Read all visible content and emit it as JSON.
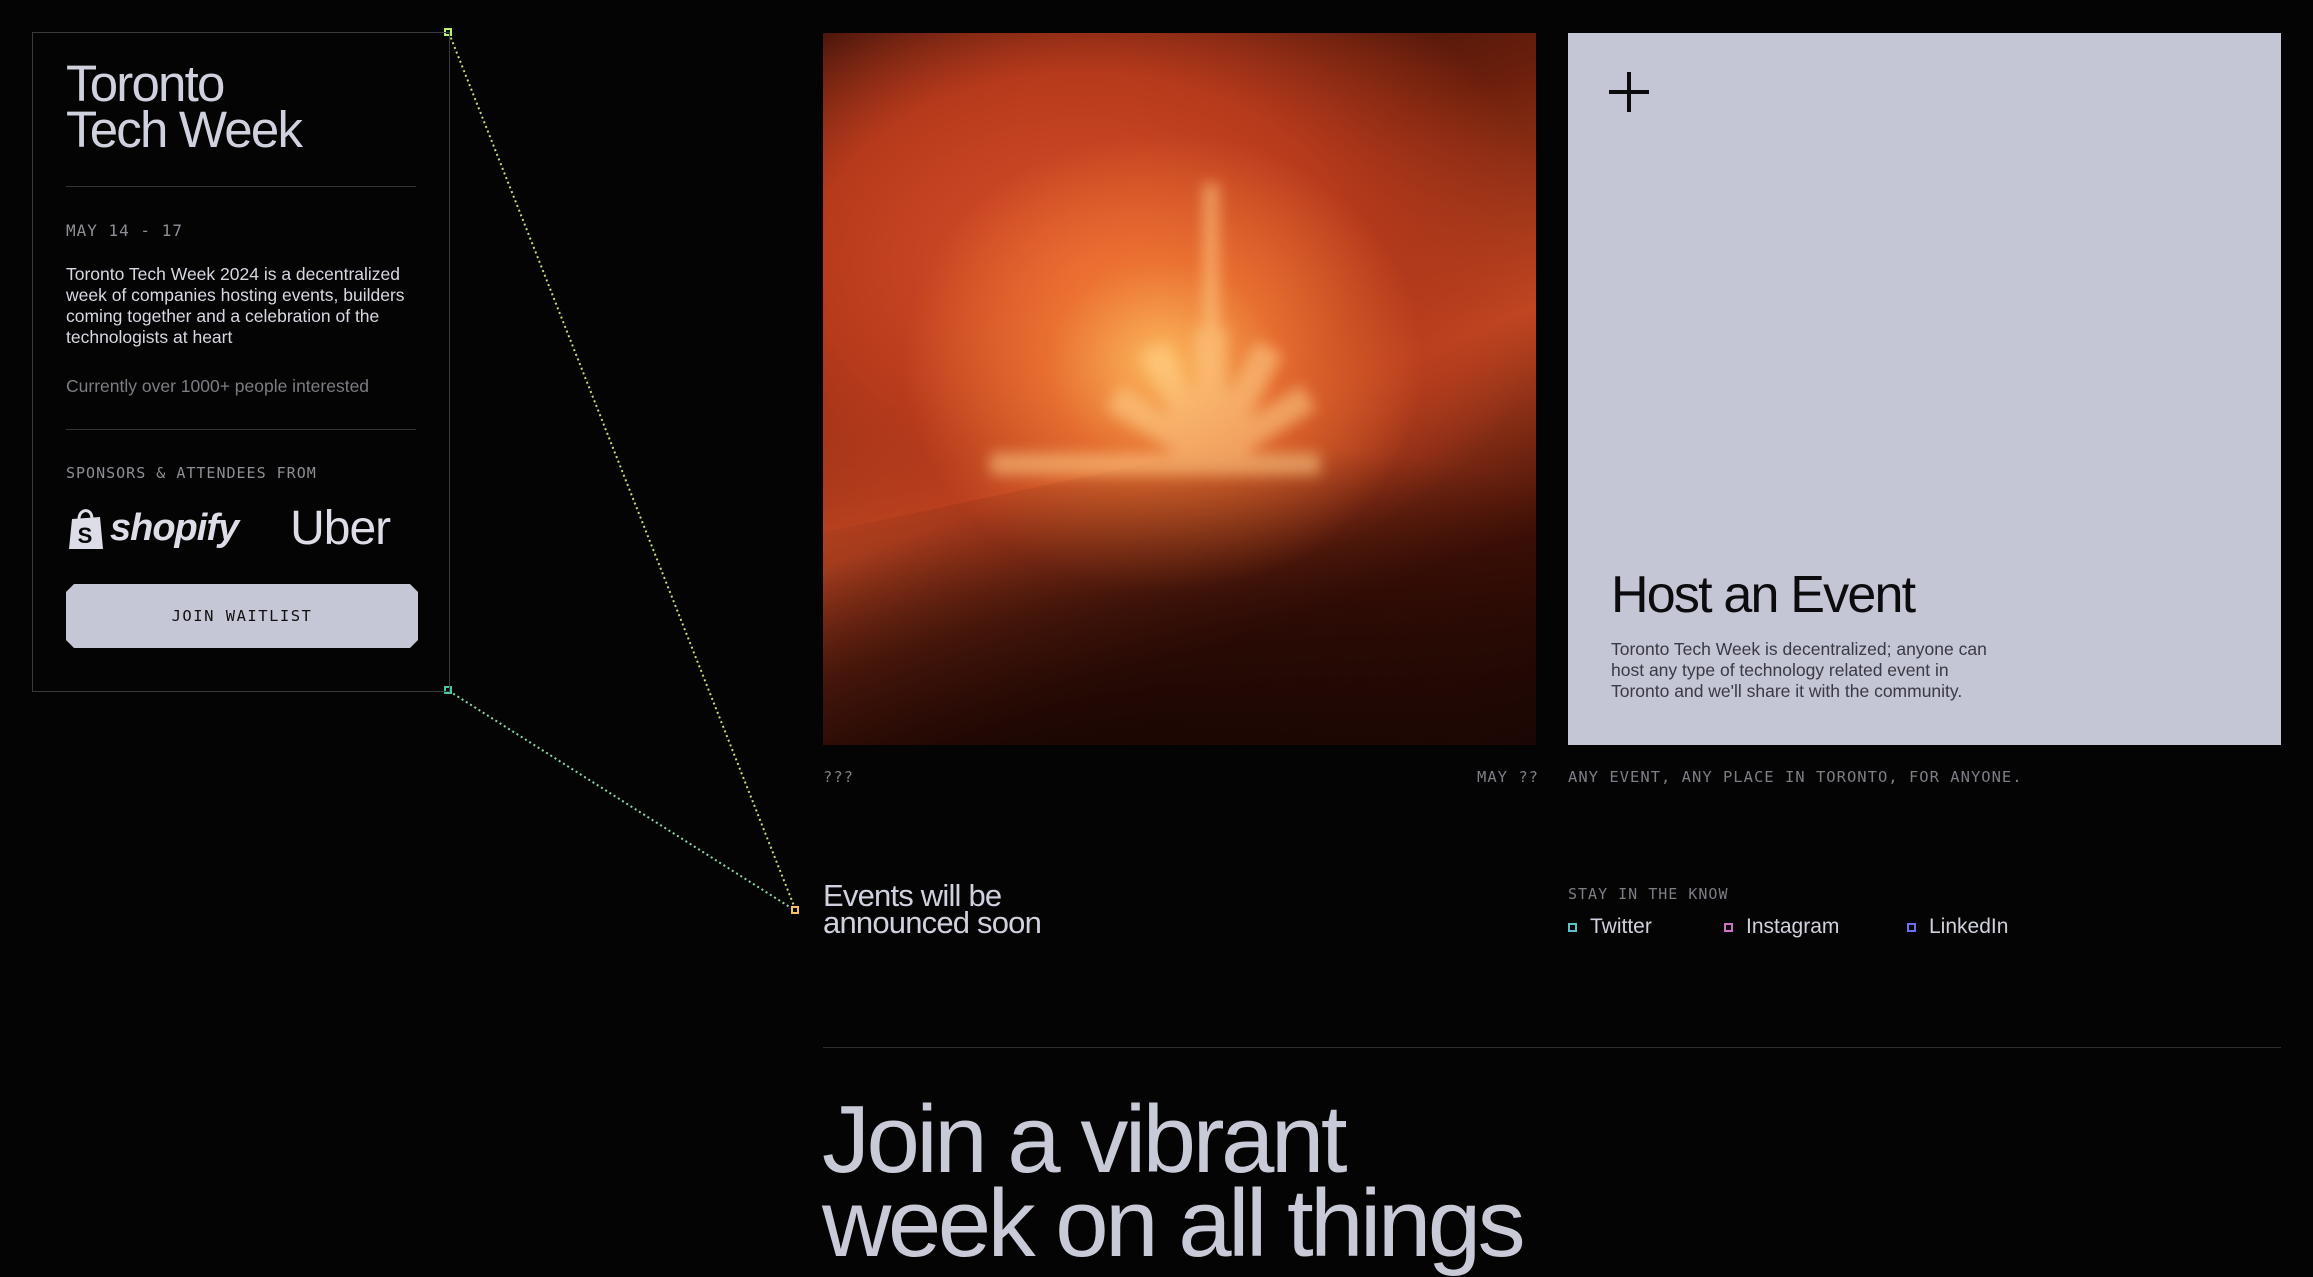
{
  "brand": {
    "title_line1": "Toronto",
    "title_line2": "Tech Week",
    "dates": "MAY 14 - 17",
    "description": "Toronto Tech Week 2024 is a decentralized week of companies hosting events, builders coming together and a celebration of the technologists at heart",
    "interested": "Currently over 1000+ people interested",
    "sponsors_label": "SPONSORS & ATTENDEES FROM",
    "sponsors": [
      "shopify",
      "Uber"
    ],
    "waitlist_button": "JOIN WAITLIST"
  },
  "hero": {
    "caption_left": "???",
    "caption_right": "MAY ??"
  },
  "host": {
    "icon": "plus-icon",
    "title": "Host an Event",
    "description": "Toronto Tech Week is decentralized; anyone can host any type of technology related event in Toronto and we'll share it with the community.",
    "caption": "ANY EVENT, ANY PLACE IN TORONTO, FOR ANYONE."
  },
  "events": {
    "line1": "Events will be",
    "line2": "announced soon"
  },
  "social": {
    "label": "STAY IN THE KNOW",
    "links": [
      {
        "label": "Twitter",
        "color": "#5bc3c9"
      },
      {
        "label": "Instagram",
        "color": "#d46fc6"
      },
      {
        "label": "LinkedIn",
        "color": "#6a6ff2"
      }
    ]
  },
  "headline": {
    "line1": "Join a vibrant",
    "line2": "week on all things"
  },
  "colors": {
    "background": "#040404",
    "card": "#c4c5d5",
    "node_green": "#b6f26a",
    "node_teal": "#45c4a0",
    "node_orange": "#f5c060"
  }
}
